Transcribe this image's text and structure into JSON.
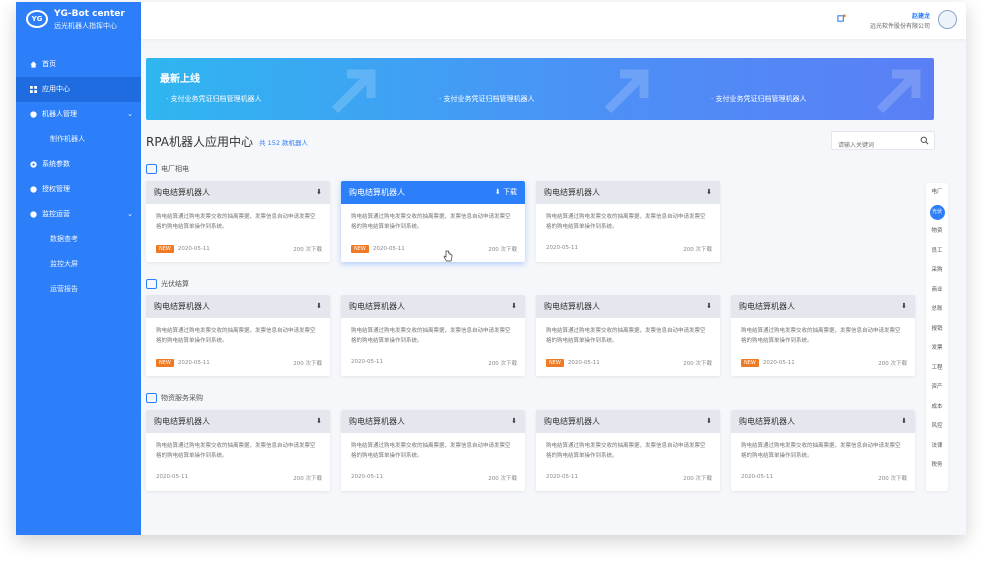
{
  "app": {
    "title": "YG-Bot center",
    "subtitle": "远光机器人指挥中心"
  },
  "sidebar": {
    "items": [
      {
        "label": "首页"
      },
      {
        "label": "应用中心"
      },
      {
        "label": "机器人管理",
        "children": [
          "制作机器人"
        ]
      },
      {
        "label": "系统参数"
      },
      {
        "label": "授权管理"
      },
      {
        "label": "监控运营",
        "children": [
          "数据查考",
          "监控大屏",
          "运营报告"
        ]
      }
    ]
  },
  "header": {
    "user_name": "赵建龙",
    "company": "远光软件股份有限公司"
  },
  "banner": {
    "title": "最新上线",
    "items": [
      "支付业务凭证归档管理机器人",
      "支付业务凭证归档管理机器人",
      "支付业务凭证归档管理机器人"
    ]
  },
  "main": {
    "title": "RPA机器人应用中心",
    "count_text": "共 152 款机器人",
    "search_placeholder": "请输入关键词"
  },
  "groups": [
    {
      "label": "电厂相电",
      "cards": [
        {
          "title": "购电结算机器人",
          "desc": "购电结算通过购电发票交收的抽离票据，发票信息自动申请发票空格的购电结算单操作到系统。",
          "new": "NEW",
          "date": "2020-05-11",
          "downloads": "200 次下载",
          "dl_label": ""
        },
        {
          "title": "购电结算机器人",
          "desc": "购电结算通过购电发票交收的抽离票据，发票信息自动申请发票空格的购电结算单操作到系统。",
          "new": "NEW",
          "date": "2020-05-11",
          "downloads": "200 次下载",
          "dl_label": "下载"
        },
        {
          "title": "购电结算机器人",
          "desc": "购电结算通过购电发票交收的抽离票据，发票信息自动申请发票空格的购电结算单操作到系统。",
          "new": "",
          "date": "2020-05-11",
          "downloads": "200 次下载",
          "dl_label": ""
        }
      ]
    },
    {
      "label": "光伏结算",
      "cards": [
        {
          "title": "购电结算机器人",
          "desc": "购电结算通过购电发票交收的抽离票据，发票信息自动申请发票空格的购电结算单操作到系统。",
          "new": "NEW",
          "date": "2020-05-11",
          "downloads": "200 次下载",
          "dl_label": ""
        },
        {
          "title": "购电结算机器人",
          "desc": "购电结算通过购电发票交收的抽离票据，发票信息自动申请发票空格的购电结算单操作到系统。",
          "new": "",
          "date": "2020-05-11",
          "downloads": "200 次下载",
          "dl_label": ""
        },
        {
          "title": "购电结算机器人",
          "desc": "购电结算通过购电发票交收的抽离票据，发票信息自动申请发票空格的购电结算单操作到系统。",
          "new": "NEW",
          "date": "2020-05-11",
          "downloads": "200 次下载",
          "dl_label": ""
        },
        {
          "title": "购电结算机器人",
          "desc": "购电结算通过购电发票交收的抽离票据，发票信息自动申请发票空格的购电结算单操作到系统。",
          "new": "NEW",
          "date": "2020-05-11",
          "downloads": "200 次下载",
          "dl_label": ""
        }
      ]
    },
    {
      "label": "物资服务采购",
      "cards": [
        {
          "title": "购电结算机器人",
          "desc": "购电结算通过购电发票交收的抽离票据，发票信息自动申请发票空格的购电结算单操作到系统。",
          "new": "",
          "date": "2020-05-11",
          "downloads": "200 次下载",
          "dl_label": ""
        },
        {
          "title": "购电结算机器人",
          "desc": "购电结算通过购电发票交收的抽离票据，发票信息自动申请发票空格的购电结算单操作到系统。",
          "new": "",
          "date": "2020-05-11",
          "downloads": "200 次下载",
          "dl_label": ""
        },
        {
          "title": "购电结算机器人",
          "desc": "购电结算通过购电发票交收的抽离票据，发票信息自动申请发票空格的购电结算单操作到系统。",
          "new": "",
          "date": "2020-05-11",
          "downloads": "200 次下载",
          "dl_label": ""
        },
        {
          "title": "购电结算机器人",
          "desc": "购电结算通过购电发票交收的抽离票据，发票信息自动申请发票空格的购电结算单操作到系统。",
          "new": "",
          "date": "2020-05-11",
          "downloads": "200 次下载",
          "dl_label": ""
        }
      ]
    }
  ],
  "index_nav": [
    "电厂",
    "光伏",
    "物资",
    "员工",
    "采购",
    "商业",
    "总账",
    "报销",
    "发票",
    "工程",
    "资产",
    "成本",
    "风控",
    "法律",
    "税务"
  ],
  "colors": {
    "primary": "#2d7ff9",
    "sidebar_active": "#1f6be0",
    "new_tag": "#f07a24"
  },
  "icons": [
    "home-icon",
    "grid-icon",
    "robot-icon",
    "gear-icon",
    "key-icon",
    "monitor-icon",
    "notification-icon",
    "search-icon",
    "download-icon"
  ]
}
